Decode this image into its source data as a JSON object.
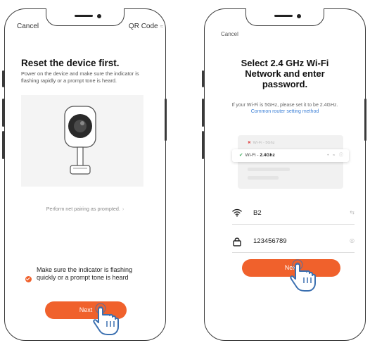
{
  "left_screen": {
    "nav": {
      "cancel_label": "Cancel",
      "qr_label": "QR Code",
      "qr_glyph": "≈"
    },
    "title": "Reset the device first.",
    "description": "Power on the device and make sure the indicator is flashing rapidly or a prompt tone is heard.",
    "perform_link": "Perform net pairing as prompted.",
    "perform_chevron": "›",
    "confirm_text": "Make sure the indicator is flashing quickly or a prompt tone is heard",
    "confirm_checked": true,
    "next_label": "Next"
  },
  "right_screen": {
    "nav": {
      "cancel_label": "Cancel"
    },
    "title": "Select 2.4 GHz Wi-Fi Network and enter password.",
    "description_prefix": "If your Wi-Fi is 5GHz, please set it to be 2.4GHz.",
    "description_link": "Common router setting method",
    "wifi_list": {
      "wrong": {
        "mark": "✖",
        "name": "Wi-Fi - 5Ghz"
      },
      "correct": {
        "mark": "✔",
        "name": "Wi-Fi - ",
        "freq": "2.4Ghz",
        "icons": "• ≈ ⓘ"
      }
    },
    "ssid_field": {
      "value": "B2",
      "right_glyph": "⇆",
      "icon": "wifi-icon"
    },
    "password_field": {
      "value": "123456789",
      "right_glyph": "◎",
      "icon": "lock-icon"
    },
    "next_label": "Next"
  },
  "colors": {
    "accent": "#f0612c",
    "link": "#3b7fd6",
    "check_green": "#3aaa5a",
    "cross_red": "#e05050"
  }
}
